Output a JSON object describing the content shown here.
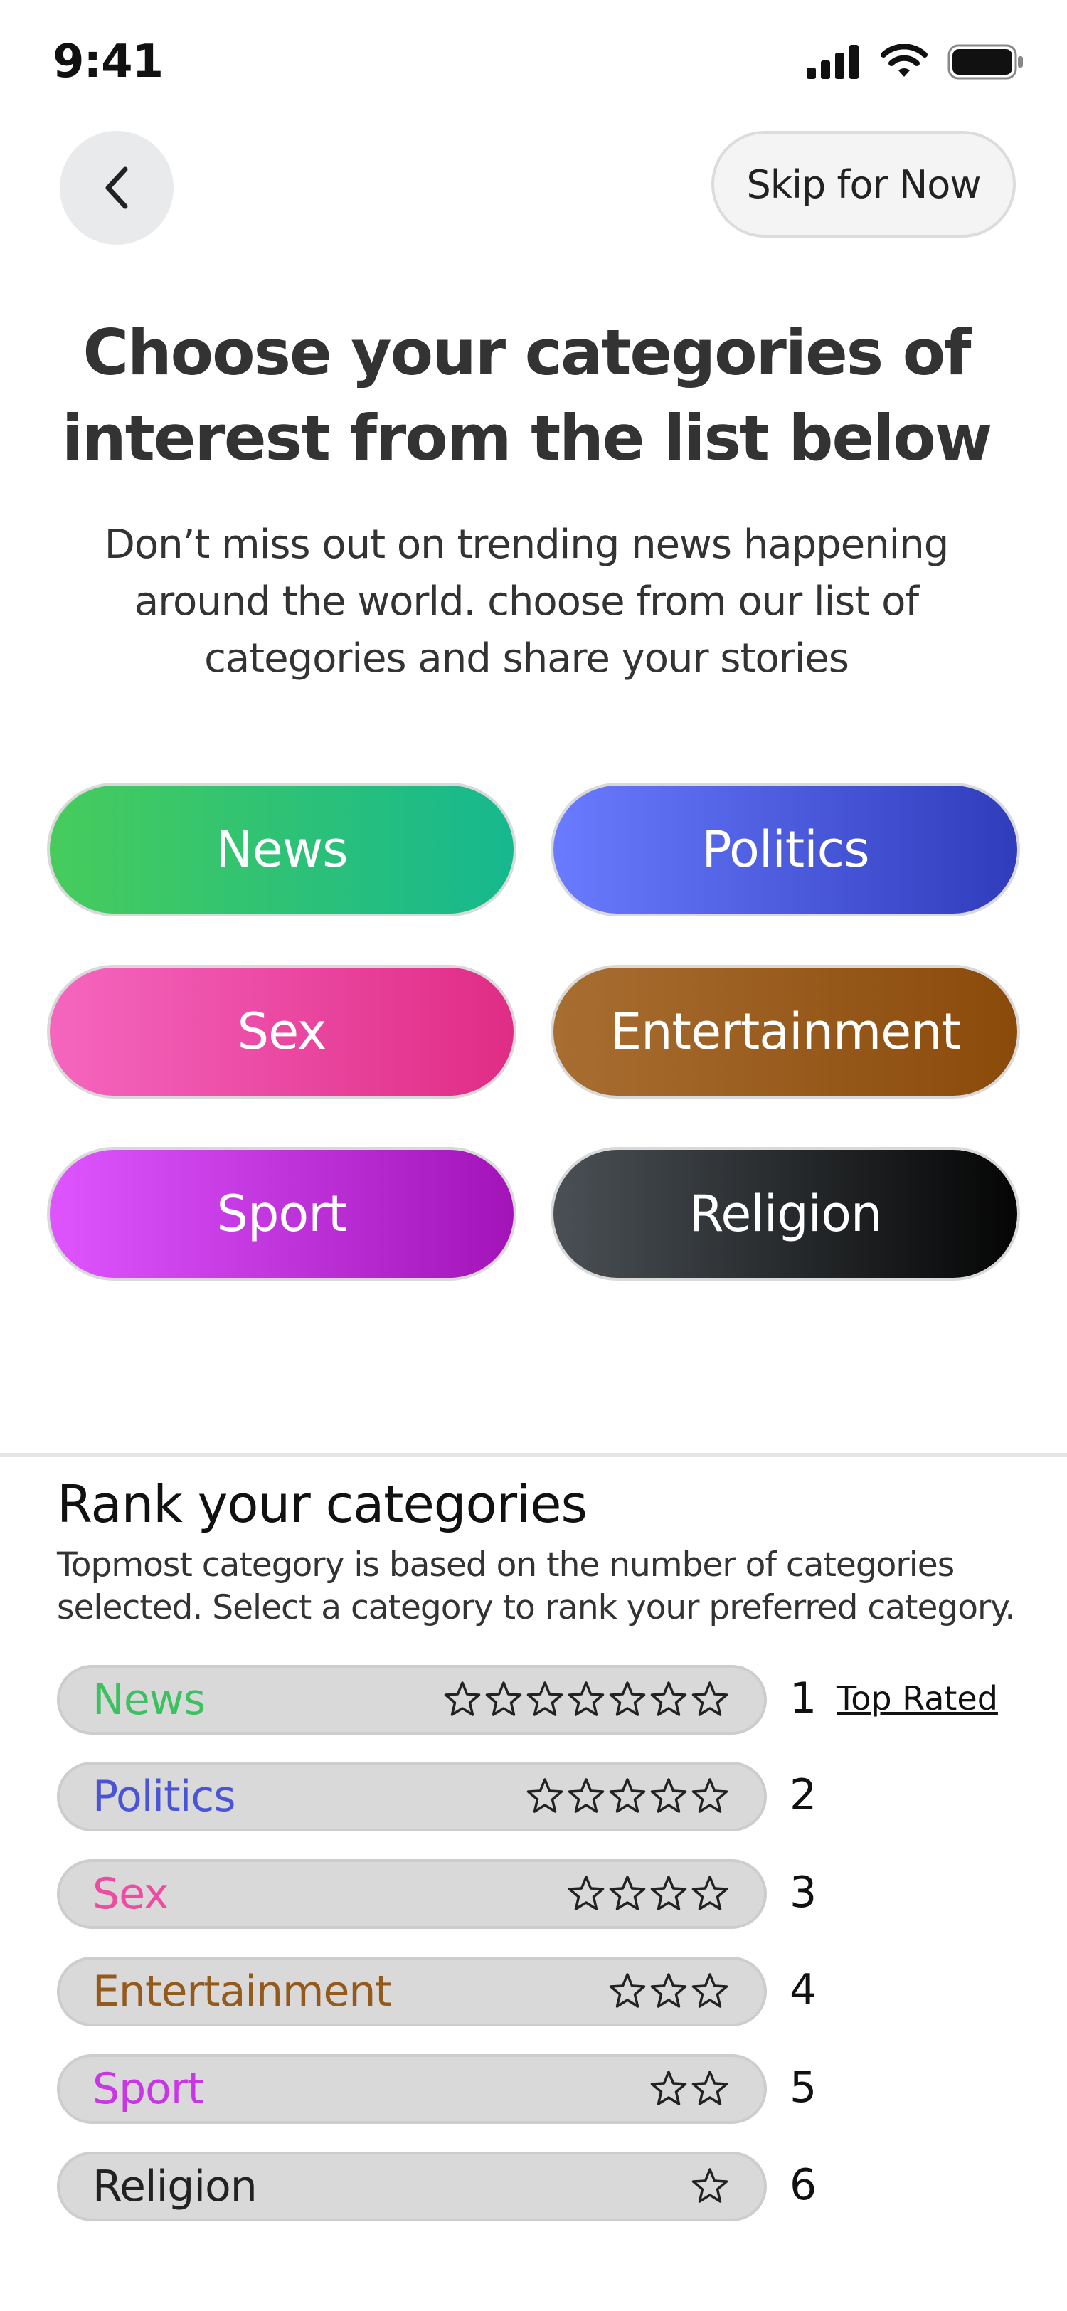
{
  "status_bar": {
    "time": "9:41",
    "icons": [
      "signal-icon",
      "wifi-icon",
      "battery-icon"
    ]
  },
  "nav": {
    "back_icon": "chevron-left-icon",
    "skip_label": "Skip for Now"
  },
  "header": {
    "title": "Choose your categories of interest from the list below",
    "subtitle": "Don’t miss out on trending news happening around the world. choose from our list of categories and  share your stories"
  },
  "categories": [
    {
      "label": "News"
    },
    {
      "label": "Politics"
    },
    {
      "label": "Sex"
    },
    {
      "label": "Entertainment"
    },
    {
      "label": "Sport"
    },
    {
      "label": "Religion"
    }
  ],
  "ranking": {
    "title": "Rank your categories",
    "description": "Topmost category is based on the number of categories selected. Select a category to rank your preferred category.",
    "top_rated_label": "Top Rated",
    "items": [
      {
        "label": "News",
        "stars": 7,
        "rank": "1",
        "color": "#3cc060"
      },
      {
        "label": "Politics",
        "stars": 5,
        "rank": "2",
        "color": "#4a55d6"
      },
      {
        "label": "Sex",
        "stars": 4,
        "rank": "3",
        "color": "#ec4ca2"
      },
      {
        "label": "Entertainment",
        "stars": 3,
        "rank": "4",
        "color": "#945a1d"
      },
      {
        "label": "Sport",
        "stars": 2,
        "rank": "5",
        "color": "#c836e6"
      },
      {
        "label": "Religion",
        "stars": 1,
        "rank": "6",
        "color": "#222222"
      }
    ]
  }
}
